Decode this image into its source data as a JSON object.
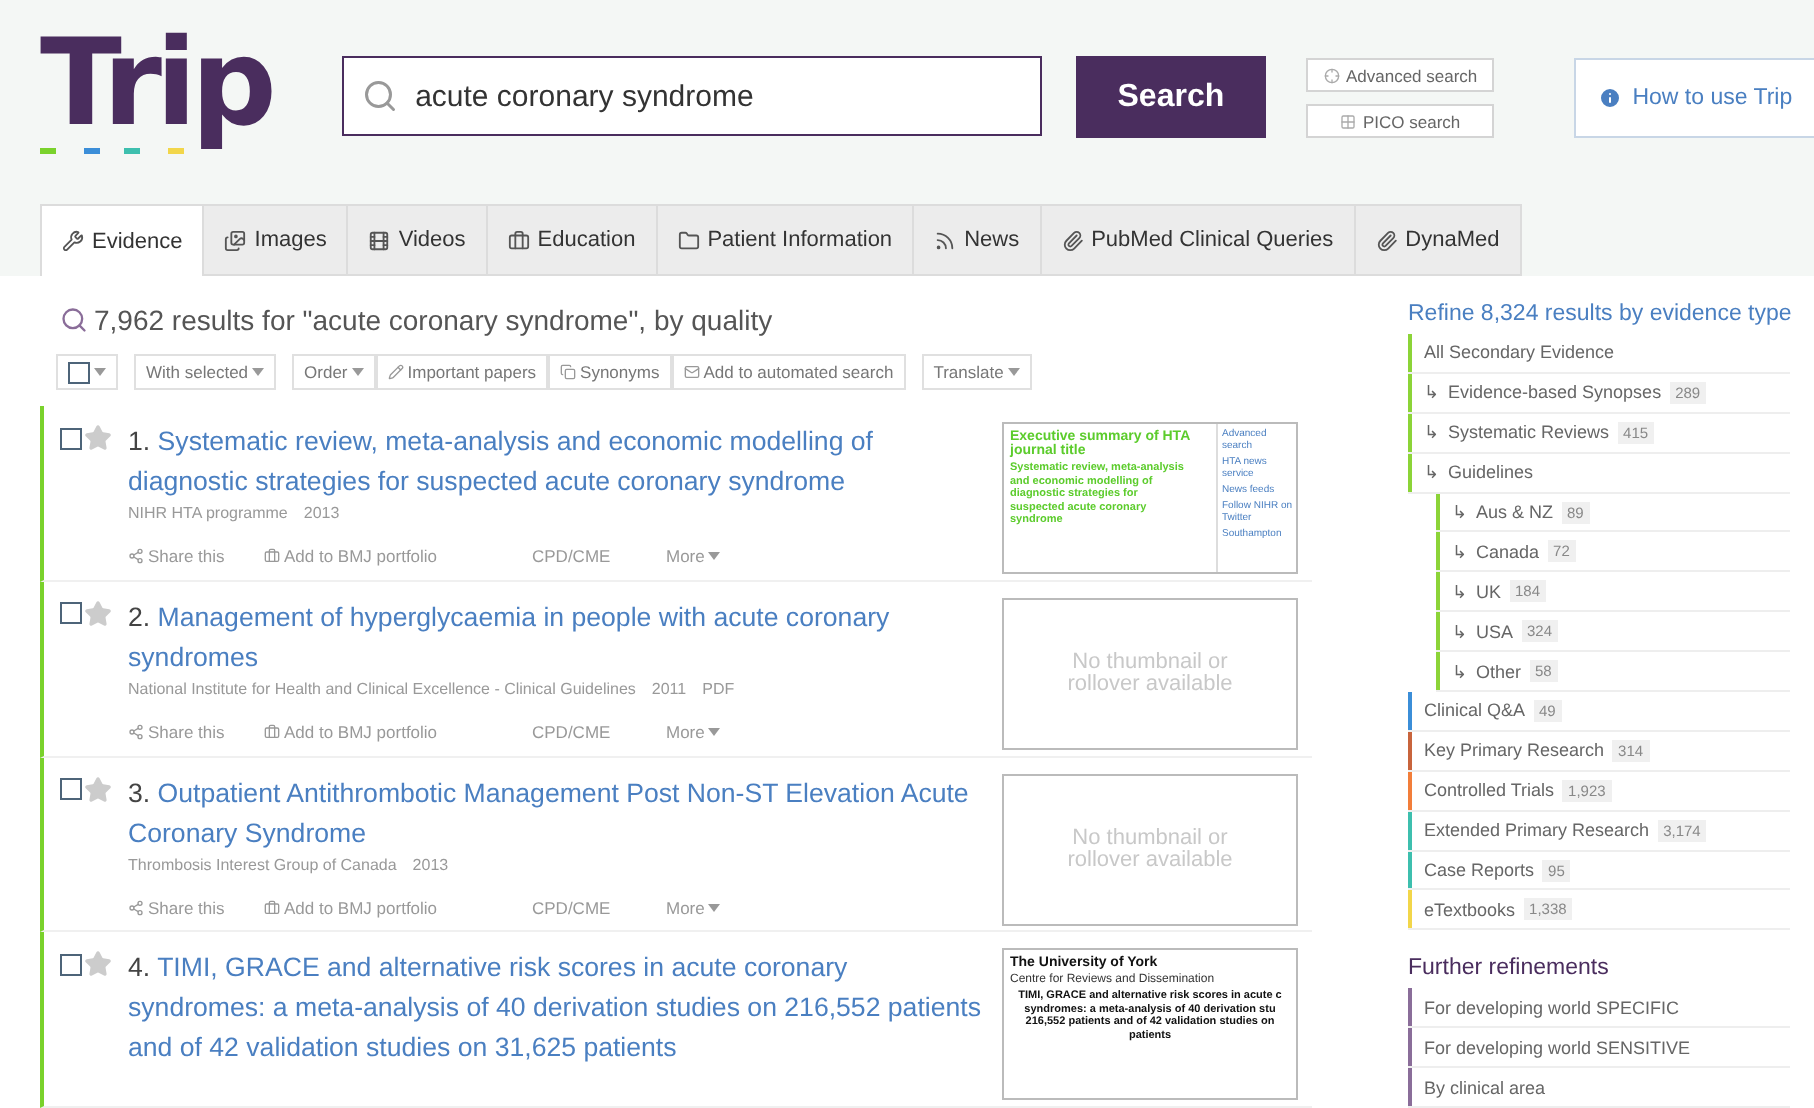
{
  "logo": {
    "text": "Trip"
  },
  "search": {
    "value": "acute coronary syndrome",
    "button": "Search"
  },
  "search_links": [
    "Advanced search",
    "PICO search"
  ],
  "help_button": "How to use Trip",
  "tabs": [
    {
      "label": "Evidence",
      "selected": true
    },
    {
      "label": "Images",
      "selected": false
    },
    {
      "label": "Videos",
      "selected": false
    },
    {
      "label": "Education",
      "selected": false
    },
    {
      "label": "Patient Information",
      "selected": false
    },
    {
      "label": "News",
      "selected": false
    },
    {
      "label": "PubMed Clinical Queries",
      "selected": false
    },
    {
      "label": "DynaMed",
      "selected": false
    }
  ],
  "results_summary": "7,962 results for \"acute coronary syndrome\", by quality",
  "toolbar": {
    "select_all": {
      "checked": false
    },
    "groups": [
      [
        {
          "label": "With selected",
          "kind": "dropdown"
        }
      ],
      [
        {
          "label": "Order",
          "kind": "dropdown"
        },
        {
          "label": "Important papers",
          "kind": "pencil"
        },
        {
          "label": "Synonyms",
          "kind": "copy"
        },
        {
          "label": "Add to automated search",
          "kind": "mail"
        }
      ],
      [
        {
          "label": "Translate",
          "kind": "dropdown"
        }
      ]
    ]
  },
  "results": [
    {
      "number": "1.",
      "title": "Systematic review, meta-analysis and economic modelling of diagnostic strategies for suspected acute coronary syndrome",
      "source": "NIHR HTA programme",
      "year": "2013",
      "checked": false,
      "starred": false,
      "actions": [
        "Share this",
        "Add to BMJ portfolio",
        "CPD/CME",
        "More"
      ],
      "thumbnail": {
        "kind": "document",
        "header": "Executive summary of HTA journal title",
        "heading_lines": [
          "Systematic review, meta-analysis",
          "and economic modelling of",
          "diagnostic strategies for",
          "suspected acute coronary",
          "syndrome"
        ],
        "sidebar": [
          "Advanced search",
          "HTA news service",
          "News feeds",
          "Follow NIHR on Twitter",
          "Southampton"
        ]
      }
    },
    {
      "number": "2.",
      "title": "Management of hyperglycaemia in people with acute coronary syndromes",
      "source": "National Institute for Health and Clinical Excellence - Clinical Guidelines",
      "year": "2011",
      "format": "PDF",
      "checked": false,
      "starred": false,
      "actions": [
        "Share this",
        "Add to BMJ portfolio",
        "CPD/CME",
        "More"
      ],
      "thumbnail": {
        "kind": "none",
        "text": "No thumbnail or rollover available"
      }
    },
    {
      "number": "3.",
      "title": "Outpatient Antithrombotic Management Post Non-ST Elevation Acute Coronary Syndrome",
      "source": "Thrombosis Interest Group of Canada",
      "year": "2013",
      "checked": false,
      "starred": false,
      "actions": [
        "Share this",
        "Add to BMJ portfolio",
        "CPD/CME",
        "More"
      ],
      "thumbnail": {
        "kind": "none",
        "text": "No thumbnail or rollover available"
      }
    },
    {
      "number": "4.",
      "title": "TIMI, GRACE and alternative risk scores in acute coronary syndromes: a meta-analysis of 40 derivation studies on 216,552 patients and of 42 validation studies on 31,625 patients",
      "checked": false,
      "starred": false,
      "thumbnail": {
        "kind": "document",
        "header": "The University of York",
        "subheader": "Centre for Reviews and Dissemination",
        "heading_lines": [
          "TIMI, GRACE and alternative risk scores in acute c",
          "syndromes: a meta-analysis of 40 derivation stu",
          "216,552 patients and of 42 validation studies on",
          "patients"
        ]
      }
    }
  ],
  "refine": {
    "title": "Refine 8,324 results by evidence type",
    "items": [
      {
        "label": "All Secondary Evidence",
        "color": "#8cd438"
      },
      {
        "prefix": "↳",
        "label": "Evidence-based Synopses",
        "count": "289",
        "color": "#8cd438"
      },
      {
        "prefix": "↳",
        "label": "Systematic Reviews",
        "count": "415",
        "color": "#8cd438"
      },
      {
        "prefix": "↳",
        "label": "Guidelines",
        "color": "#8cd438",
        "children": [
          {
            "prefix": "↳",
            "label": "Aus & NZ",
            "count": "89",
            "color": "#8cd438"
          },
          {
            "prefix": "↳",
            "label": "Canada",
            "count": "72",
            "color": "#8cd438"
          },
          {
            "prefix": "↳",
            "label": "UK",
            "count": "184",
            "color": "#8cd438"
          },
          {
            "prefix": "↳",
            "label": "USA",
            "count": "324",
            "color": "#8cd438"
          },
          {
            "prefix": "↳",
            "label": "Other",
            "count": "58",
            "color": "#8cd438"
          }
        ]
      },
      {
        "label": "Clinical Q&A",
        "count": "49",
        "color": "#3b8ed8"
      },
      {
        "label": "Key Primary Research",
        "count": "314",
        "color": "#c8643c"
      },
      {
        "label": "Controlled Trials",
        "count": "1,923",
        "color": "#f27e3a"
      },
      {
        "label": "Extended Primary Research",
        "count": "3,174",
        "color": "#3dbfae"
      },
      {
        "label": "Case Reports",
        "count": "95",
        "color": "#3dbfae"
      },
      {
        "label": "eTextbooks",
        "count": "1,338",
        "color": "#f2d64a"
      }
    ]
  },
  "further": {
    "title": "Further refinements",
    "items": [
      {
        "label": "For developing world SPECIFIC",
        "color": "#8a6d99"
      },
      {
        "label": "For developing world SENSITIVE",
        "color": "#8a6d99"
      },
      {
        "label": "By clinical area",
        "color": "#8a6d99"
      }
    ]
  }
}
